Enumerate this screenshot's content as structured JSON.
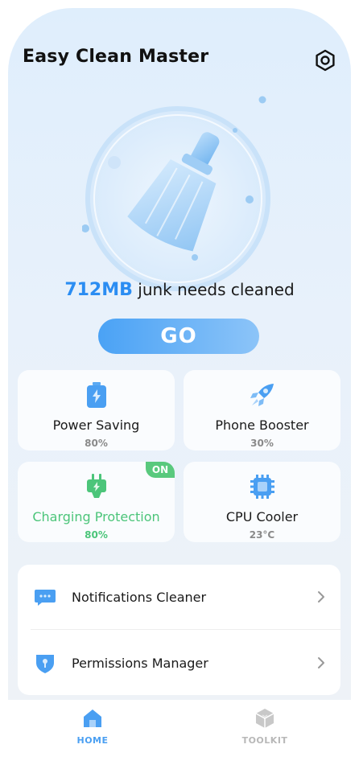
{
  "app": {
    "title": "Easy Clean Master"
  },
  "hero": {
    "junk_amount": "712MB",
    "junk_text": "junk needs cleaned",
    "go_label": "GO"
  },
  "features": [
    {
      "label": "Power Saving",
      "value": "80%",
      "icon": "battery-icon"
    },
    {
      "label": "Phone Booster",
      "value": "30%",
      "icon": "rocket-icon"
    },
    {
      "label": "Charging Protection",
      "value": "80%",
      "icon": "charging-plug-icon",
      "badge": "ON",
      "accent": "#4cc57a"
    },
    {
      "label": "CPU Cooler",
      "value": "23°C",
      "icon": "cpu-chip-icon"
    }
  ],
  "list": [
    {
      "label": "Notifications Cleaner",
      "icon": "notification-bubble-icon"
    },
    {
      "label": "Permissions Manager",
      "icon": "shield-icon"
    }
  ],
  "tabbar": [
    {
      "label": "HOME",
      "active": true,
      "icon": "home-icon"
    },
    {
      "label": "TOOLKIT",
      "active": false,
      "icon": "toolkit-cube-icon"
    }
  ],
  "colors": {
    "accent_blue": "#2b8df2",
    "accent_green": "#4cc57a",
    "muted": "#8a8a8a"
  }
}
